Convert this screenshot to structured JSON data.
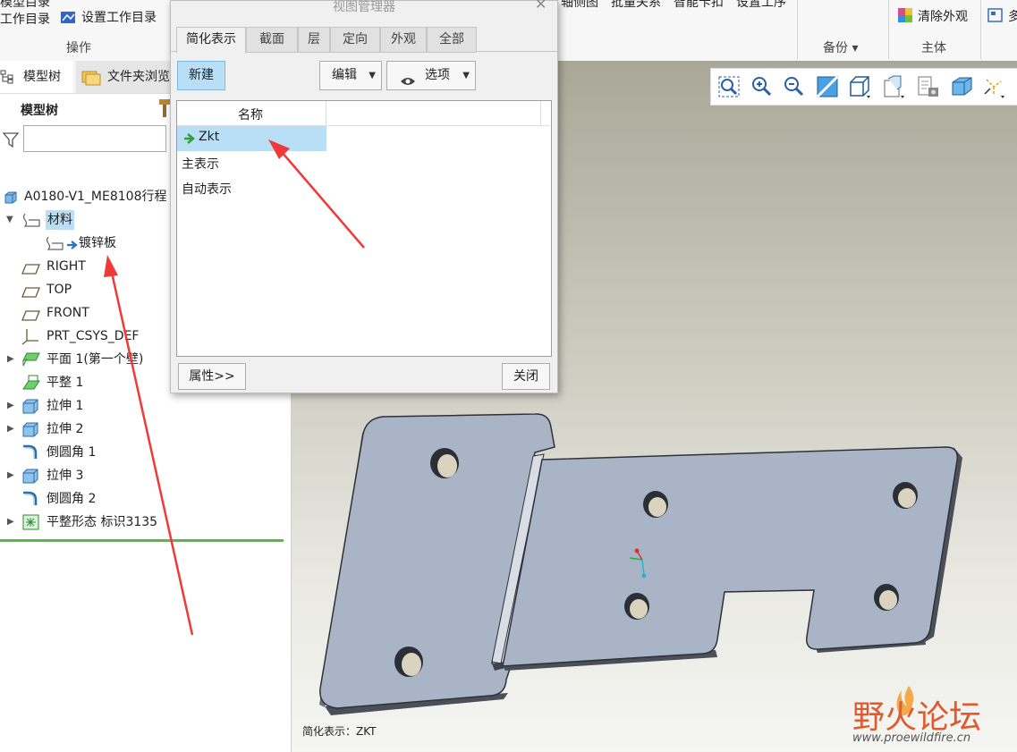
{
  "ribbon": {
    "top_left_line1": "模型目录",
    "top_left_line2": "工作目录",
    "set_workdir": "设置工作目录",
    "group_operation": "操作",
    "top_right_items": [
      "轴侧图",
      "批量关系",
      "智能卡扣",
      "设置工序"
    ],
    "clear_appearance": "清除外观",
    "more": "多",
    "group_backup": "备份",
    "group_body": "主体"
  },
  "left_panel": {
    "tab_model_tree": "模型树",
    "tab_folder_browser": "文件夹浏览",
    "header": "模型树",
    "search_value": "",
    "tree": [
      {
        "label": "A0180-V1_ME8108行程",
        "icon": "part-icon"
      },
      {
        "label": "材料",
        "icon": "material-icon"
      },
      {
        "label": "镀锌板",
        "icon": "material-arrow-icon"
      },
      {
        "label": "RIGHT",
        "icon": "datum-plane-icon"
      },
      {
        "label": "TOP",
        "icon": "datum-plane-icon"
      },
      {
        "label": "FRONT",
        "icon": "datum-plane-icon"
      },
      {
        "label": "PRT_CSYS_DEF",
        "icon": "csys-icon"
      },
      {
        "label": "平面 1(第一个壁)",
        "icon": "planar-wall-icon"
      },
      {
        "label": "平整 1",
        "icon": "flat-wall-icon"
      },
      {
        "label": "拉伸 1",
        "icon": "extrude-icon"
      },
      {
        "label": "拉伸 2",
        "icon": "extrude-icon"
      },
      {
        "label": "倒圆角 1",
        "icon": "round-icon"
      },
      {
        "label": "拉伸 3",
        "icon": "extrude-icon"
      },
      {
        "label": "倒圆角 2",
        "icon": "round-icon"
      },
      {
        "label": "平整形态 标识3135",
        "icon": "flat-state-icon"
      }
    ]
  },
  "dialog": {
    "title": "视图管理器",
    "tabs": [
      "简化表示",
      "截面",
      "层",
      "定向",
      "外观",
      "全部"
    ],
    "new_button": "新建",
    "edit_button": "编辑",
    "options_button": "选项",
    "column_name": "名称",
    "rows": [
      "Zkt",
      "主表示",
      "自动表示"
    ],
    "properties_button": "属性>>",
    "close_button": "关闭"
  },
  "viewport": {
    "status_text": "简化表示：ZKT",
    "watermark_cn": "野火论坛",
    "watermark_url": "www.proewildfire.cn"
  },
  "colors": {
    "selection": "#b9dff7",
    "part_face": "#a8b4c8",
    "annotation_arrow": "#f03a3a",
    "tree_separator": "#58b948"
  }
}
